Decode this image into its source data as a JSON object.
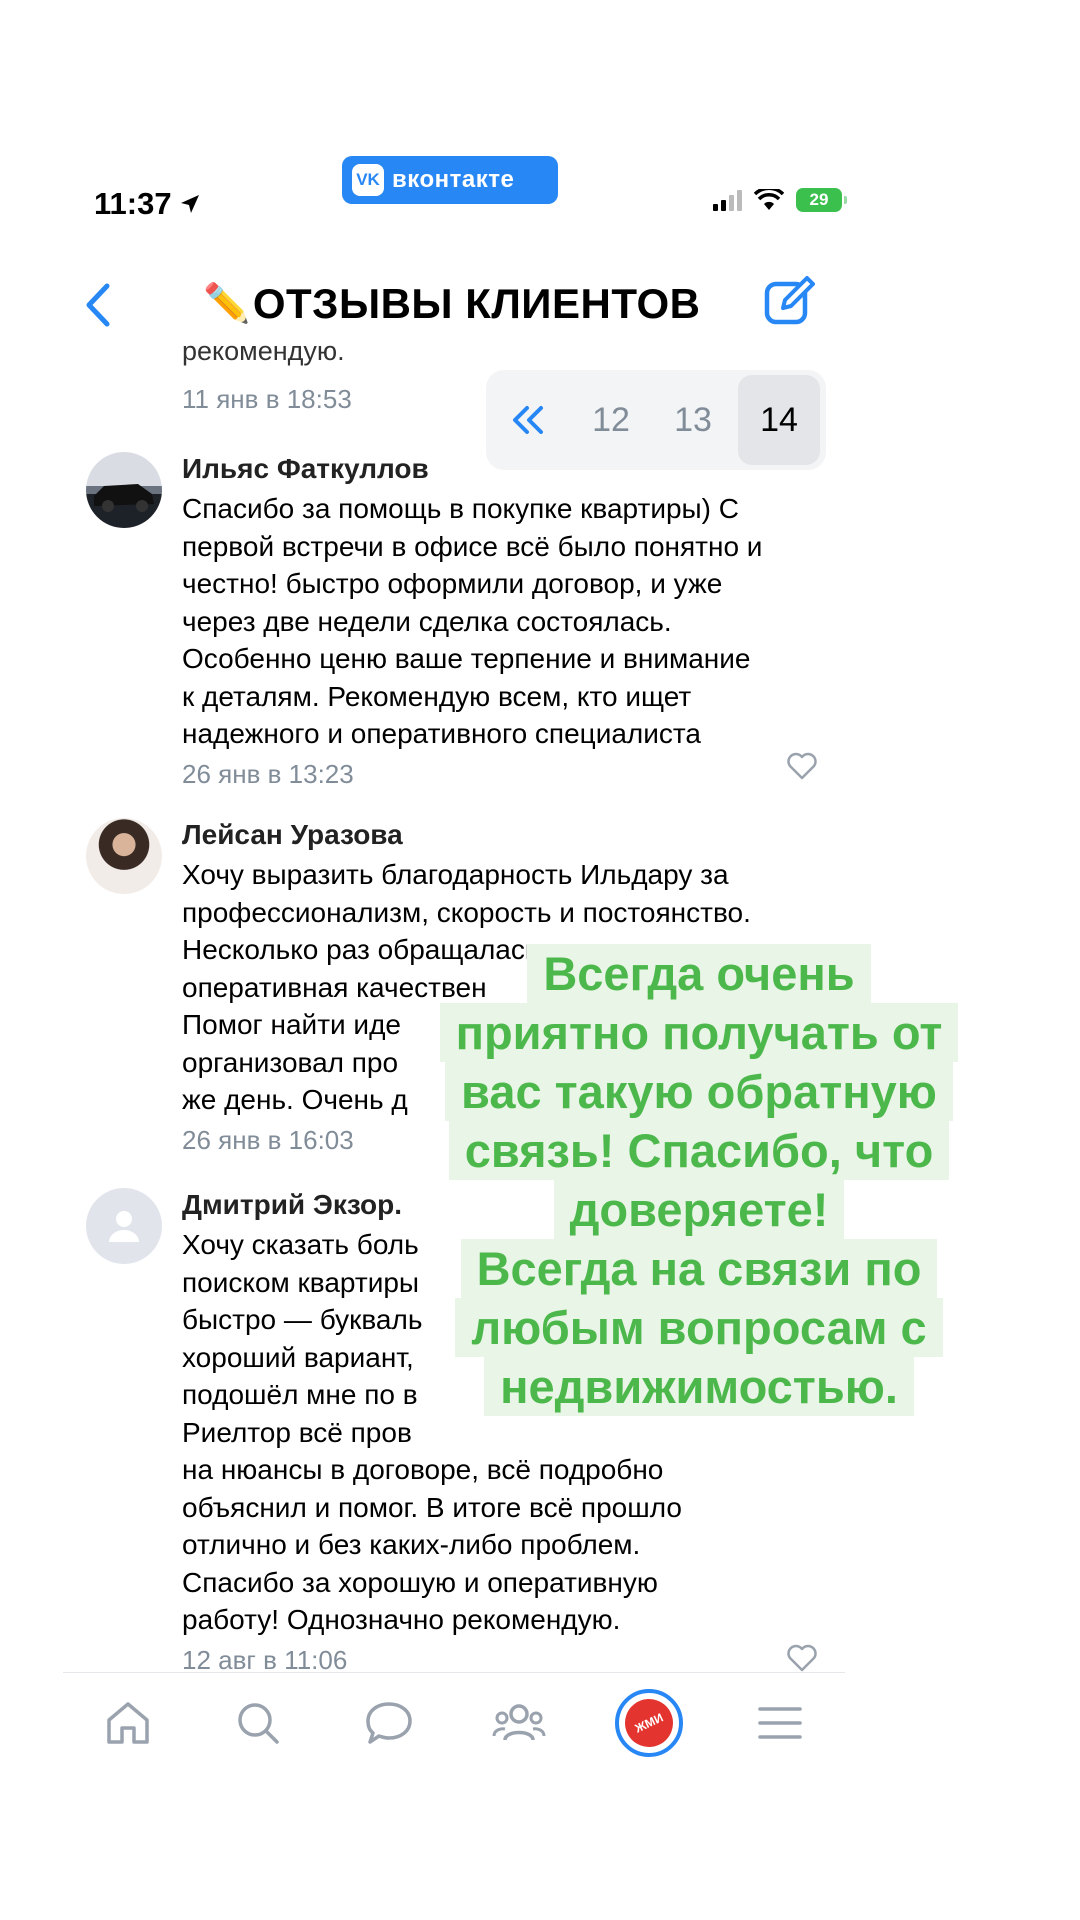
{
  "app": {
    "name": "вконтакте",
    "logo": "vk-logo"
  },
  "status": {
    "time": "11:37",
    "battery": "29"
  },
  "nav": {
    "title": "ОТЗЫВЫ КЛИЕНТОВ",
    "title_emoji": "✏️"
  },
  "previous": {
    "text": "рекомендую.",
    "date": "11 янв в 18:53"
  },
  "pagination": {
    "pages": [
      "12",
      "13",
      "14"
    ],
    "current": "14"
  },
  "comments": [
    {
      "author": "Ильяс Фаткуллов",
      "lines": [
        "Спасибо за помощь в покупке квартиры) С",
        "первой встречи в офисе всё было понятно и",
        "честно! быстро оформили договор, и уже",
        "через две недели сделка состоялась.",
        "Особенно ценю ваше терпение и внимание",
        "к деталям. Рекомендую всем, кто ищет",
        "надежного и оперативного специалиста"
      ],
      "date": "26 янв в 13:23"
    },
    {
      "author": "Лейсан Уразова",
      "lines": [
        "Хочу выразить благодарность Ильдару за",
        "профессионализм, скорость и постоянство.",
        "Несколько раз обращалась к нему, всегда",
        "оперативная качествен",
        "Помог найти иде",
        "организовал про",
        "же день. Очень д"
      ],
      "date": "26 янв в 16:03"
    },
    {
      "author": "Дмитрий Экзор.",
      "lines": [
        "Хочу сказать боль",
        "поиском квартиры",
        "быстро — букваль",
        "хороший вариант,",
        "подошёл мне по в",
        "Риелтор всё пров",
        "на нюансы в договоре, всё подробно",
        "объяснил и помог. В итоге всё прошло",
        "отлично и без каких-либо проблем.",
        "Спасибо за хорошую и оперативную",
        "работу! Однозначно рекомендую."
      ],
      "date": "12 авг в 11:06"
    }
  ],
  "overlay_lines": [
    "Всегда очень",
    "приятно получать от",
    "вас такую обратную",
    "связь! Спасибо, что",
    "доверяете!",
    "Всегда на связи по",
    "любым вопросам с",
    "недвижимостью."
  ],
  "tabs": [
    "home-icon",
    "search-icon",
    "messages-icon",
    "friends-icon",
    "zhmi-icon",
    "menu-icon"
  ],
  "zhmi_label": "ЖМИ",
  "colors": {
    "accent": "#2787f5",
    "overlay_text": "#4cb84c",
    "overlay_bg": "#e9f5e6"
  }
}
